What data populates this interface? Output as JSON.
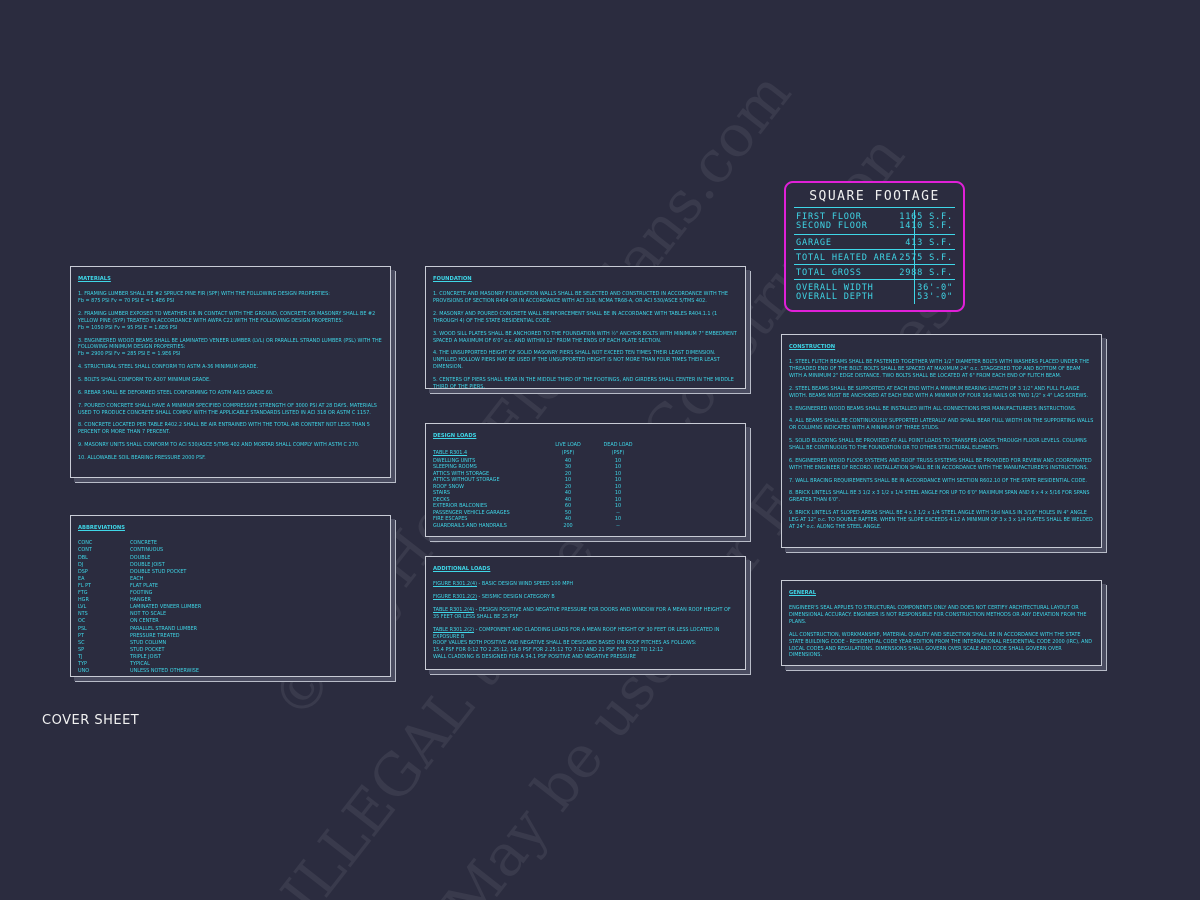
{
  "watermark": {
    "line1": "© MyHomeFloorPlans.com",
    "line2": "ILLEGAL to use for Construction",
    "line3": "May be used for Estimates"
  },
  "materials": {
    "title": "MATERIALS",
    "paras": [
      "1. FRAMING LUMBER SHALL BE #2 SPRUCE PINE FIR (SPF) WITH THE FOLLOWING DESIGN PROPERTIES:",
      "Fb = 875 PSI      Fv = 70 PSI      E = 1.4E6 PSI",
      "2. FRAMING LUMBER EXPOSED TO WEATHER OR IN CONTACT WITH THE GROUND, CONCRETE OR MASONRY SHALL BE #2 YELLOW PINE (SYP) TREATED IN ACCORDANCE WITH AWPA C22 WITH THE FOLLOWING DESIGN PROPERTIES:",
      "Fb = 1050 PSI      Fv = 95 PSI      E = 1.6E6 PSI",
      "3. ENGINEERED WOOD BEAMS SHALL BE LAMINATED VENEER LUMBER (LVL) OR PARALLEL STRAND LUMBER (PSL) WITH THE FOLLOWING MINIMUM DESIGN PROPERTIES:",
      "Fb = 2900 PSI      Fv = 285 PSI      E = 1.9E6 PSI",
      "4. STRUCTURAL STEEL SHALL CONFORM TO ASTM A-36 MINIMUM GRADE.",
      "5. BOLTS SHALL CONFORM TO A307 MINIMUM GRADE.",
      "6. REBAR SHALL BE DEFORMED STEEL CONFORMING TO ASTM A615 GRADE 60.",
      "7. POURED CONCRETE SHALL HAVE A MINIMUM SPECIFIED COMPRESSIVE STRENGTH OF 3000 PSI AT 28 DAYS. MATERIALS USED TO PRODUCE CONCRETE SHALL COMPLY WITH THE APPLICABLE STANDARDS LISTED IN ACI 318 OR ASTM C 1157.",
      "8. CONCRETE LOCATED PER TABLE R402.2 SHALL BE AIR ENTRAINED WITH THE TOTAL AIR CONTENT NOT LESS THAN 5 PERCENT OR MORE THAN 7 PERCENT.",
      "9. MASONRY UNITS SHALL CONFORM TO ACI 530/ASCE 5/TMS 402 AND MORTAR SHALL COMPLY WITH ASTM C 270.",
      "10. ALLOWABLE SOIL BEARING PRESSURE 2000 PSF."
    ]
  },
  "abbreviations": {
    "title": "ABBREVIATIONS",
    "rows": [
      [
        "CONC",
        "CONCRETE"
      ],
      [
        "CONT",
        "CONTINUOUS"
      ],
      [
        "DBL",
        "DOUBLE"
      ],
      [
        "DJ",
        "DOUBLE JOIST"
      ],
      [
        "DSP",
        "DOUBLE STUD POCKET"
      ],
      [
        "EA",
        "EACH"
      ],
      [
        "FL PT",
        "FLAT PLATE"
      ],
      [
        "FTG",
        "FOOTING"
      ],
      [
        "HGR",
        "HANGER"
      ],
      [
        "LVL",
        "LAMINATED VENEER LUMBER"
      ],
      [
        "NTS",
        "NOT TO SCALE"
      ],
      [
        "OC",
        "ON CENTER"
      ],
      [
        "PSL",
        "PARALLEL STRAND LUMBER"
      ],
      [
        "PT",
        "PRESSURE TREATED"
      ],
      [
        "SC",
        "STUD COLUMN"
      ],
      [
        "SP",
        "STUD POCKET"
      ],
      [
        "TJ",
        "TRIPLE JOIST"
      ],
      [
        "TYP",
        "TYPICAL"
      ],
      [
        "UNO",
        "UNLESS NOTED OTHERWISE"
      ]
    ]
  },
  "foundation": {
    "title": "FOUNDATION",
    "paras": [
      "1. CONCRETE AND MASONRY FOUNDATION WALLS SHALL BE SELECTED AND CONSTRUCTED IN ACCORDANCE WITH THE PROVISIONS OF SECTION R404 OR IN ACCORDANCE WITH ACI 318, NCMA TR68-A, OR ACI 530/ASCE 5/TMS 402.",
      "2. MASONRY AND POURED CONCRETE WALL REINFORCEMENT SHALL BE IN ACCORDANCE WITH TABLES R404.1.1 (1 THROUGH 4) OF THE STATE RESIDENTIAL CODE.",
      "3. WOOD SILL PLATES SHALL BE ANCHORED TO THE FOUNDATION WITH ½\" ANCHOR BOLTS WITH MINIMUM 7\" EMBEDMENT SPACED A MAXIMUM OF 6'0\" o.c. AND WITHIN 12\" FROM THE ENDS OF EACH PLATE SECTION.",
      "4. THE UNSUPPORTED HEIGHT OF SOLID MASONRY PIERS SHALL NOT EXCEED TEN TIMES THEIR LEAST DIMENSION. UNFILLED HOLLOW PIERS MAY BE USED IF THE UNSUPPORTED HEIGHT IS NOT MORE THAN FOUR TIMES THEIR LEAST DIMENSION.",
      "5. CENTERS OF PIERS SHALL BEAR IN THE MIDDLE THIRD OF THE FOOTINGS, AND GIRDERS SHALL CENTER IN THE MIDDLE THIRD OF THE PIERS."
    ]
  },
  "design_loads": {
    "title": "DESIGN LOADS",
    "col_live": "LIVE LOAD",
    "col_dead": "DEAD LOAD",
    "unit_live": "(PSF)",
    "unit_dead": "(PSF)",
    "table_ref": "TABLE R301.4",
    "rows": [
      [
        "DWELLING UNITS",
        "40",
        "10"
      ],
      [
        "SLEEPING ROOMS",
        "30",
        "10"
      ],
      [
        "ATTICS WITH STORAGE",
        "20",
        "10"
      ],
      [
        "ATTICS WITHOUT STORAGE",
        "10",
        "10"
      ],
      [
        "ROOF SNOW",
        "20",
        "10"
      ],
      [
        "STAIRS",
        "40",
        "10"
      ],
      [
        "DECKS",
        "40",
        "10"
      ],
      [
        "EXTERIOR BALCONIES",
        "60",
        "10"
      ],
      [
        "PASSENGER VEHICLE GARAGES",
        "50",
        "--"
      ],
      [
        "FIRE ESCAPES",
        "40",
        "10"
      ],
      [
        "GUARDRAILS AND HANDRAILS",
        "200",
        "--"
      ]
    ]
  },
  "additional_loads": {
    "title": "ADDITIONAL LOADS",
    "items": [
      {
        "ref": "FIGURE R301.2(4)",
        "text": " - BASIC DESIGN WIND SPEED 100 MPH"
      },
      {
        "ref": "FIGURE R301.2(2)",
        "text": " - SEISMIC DESIGN CATEGORY B"
      },
      {
        "ref": "TABLE R301.2(4)",
        "text": " - DESIGN POSITIVE AND NEGATIVE PRESSURE FOR DOORS AND WINDOW FOR A MEAN ROOF HEIGHT OF 35 FEET OR LESS SHALL BE 25 PSF"
      },
      {
        "ref": "TABLE R301.2(2)",
        "text": " - COMPONENT AND CLADDING LOADS FOR A MEAN ROOF HEIGHT OF 30 FEET OR LESS LOCATED IN EXPOSURE B"
      }
    ],
    "extra": [
      "ROOF VALUES BOTH POSITIVE AND NEGATIVE SHALL BE DESIGNED BASED ON ROOF PITCHES AS FOLLOWS:",
      "15.4 PSF FOR 0:12 TO 2.25:12, 14.8 PSF FOR 2.25:12 TO 7:12 AND 21 PSF FOR 7:12 TO 12:12",
      "WALL CLADDING IS DESIGNED FOR A 34.1 PSF POSITIVE AND NEGATIVE PRESSURE"
    ]
  },
  "square_footage": {
    "title": "SQUARE FOOTAGE",
    "first_floor_label": "FIRST FLOOR",
    "first_floor_value": "1165 S.F.",
    "second_floor_label": "SECOND FLOOR",
    "second_floor_value": "1410 S.F.",
    "garage_label": "GARAGE",
    "garage_value": "413 S.F.",
    "heated_label": "TOTAL HEATED AREA",
    "heated_value": "2575 S.F.",
    "gross_label": "TOTAL GROSS",
    "gross_value": "2988 S.F.",
    "width_label": "OVERALL WIDTH",
    "width_value": "36'-0\"",
    "depth_label": "OVERALL DEPTH",
    "depth_value": "53'-0\""
  },
  "construction": {
    "title": "CONSTRUCTION",
    "paras": [
      "1. STEEL FLITCH BEAMS SHALL BE FASTENED TOGETHER WITH 1/2\" DIAMETER BOLTS WITH WASHERS PLACED UNDER THE THREADED END OF THE BOLT. BOLTS SHALL BE SPACED AT MAXIMUM 24\" o.c. STAGGERED TOP AND BOTTOM OF BEAM WITH A MINIMUM 2\" EDGE DISTANCE. TWO BOLTS SHALL BE LOCATED AT 6\" FROM EACH END OF FLITCH BEAM.",
      "2. STEEL BEAMS SHALL BE SUPPORTED AT EACH END WITH A MINIMUM BEARING LENGTH OF 3 1/2\" AND FULL FLANGE WIDTH. BEAMS MUST BE ANCHORED AT EACH END WITH A MINIMUM OF FOUR 16d NAILS OR TWO 1/2\" x 4\" LAG SCREWS.",
      "3. ENGINEERED WOOD BEAMS SHALL BE INSTALLED WITH ALL CONNECTIONS PER MANUFACTURER'S INSTRUCTIONS.",
      "4. ALL BEAMS SHALL BE CONTINUOUSLY SUPPORTED LATERALLY AND SHALL BEAR FULL WIDTH ON THE SUPPORTING WALLS OR COLUMNS INDICATED WITH A MINIMUM OF THREE STUDS.",
      "5. SOLID BLOCKING SHALL BE PROVIDED AT ALL POINT LOADS TO TRANSFER LOADS THROUGH FLOOR LEVELS. COLUMNS SHALL BE CONTINUOUS TO THE FOUNDATION OR TO OTHER STRUCTURAL ELEMENTS.",
      "6. ENGINEERED WOOD FLOOR SYSTEMS AND ROOF TRUSS SYSTEMS SHALL BE PROVIDED FOR REVIEW AND COORDINATED WITH THE ENGINEER OF RECORD. INSTALLATION SHALL BE IN ACCORDANCE WITH THE MANUFACTURER'S INSTRUCTIONS.",
      "7. WALL BRACING REQUIREMENTS SHALL BE IN ACCORDANCE WITH SECTION R602.10 OF THE STATE RESIDENTIAL CODE.",
      "8. BRICK LINTELS SHALL BE 3 1/2 x 3 1/2 x 1/4 STEEL ANGLE FOR UP TO 6'0\" MAXIMUM SPAN AND 6 x 4 x 5/16 FOR SPANS GREATER THAN 6'0\".",
      "9. BRICK LINTELS AT SLOPED AREAS SHALL BE 4 x 3 1/2 x 1/4 STEEL ANGLE WITH 16d NAILS IN 3/16\" HOLES IN 4\" ANGLE LEG AT 12\" o.c. TO DOUBLE RAFTER. WHEN THE SLOPE EXCEEDS 4:12 A MINIMUM OF 3 x 3 x 1/4 PLATES SHALL BE WELDED AT 24\" o.c. ALONG THE STEEL ANGLE."
    ]
  },
  "general": {
    "title": "GENERAL",
    "paras": [
      "ENGINEER'S SEAL APPLIES TO STRUCTURAL COMPONENTS ONLY AND DOES NOT CERTIFY ARCHITECTURAL LAYOUT OR DIMENSIONAL ACCURACY. ENGINEER IS NOT RESPONSIBLE FOR CONSTRUCTION METHODS OR ANY DEVIATION FROM THE PLANS.",
      "ALL CONSTRUCTION, WORKMANSHIP, MATERIAL QUALITY AND SELECTION SHALL BE IN ACCORDANCE WITH THE STATE STATE BUILDING CODE - RESIDENTIAL CODE YEAR EDITION FROM THE INTERNATIONAL RESIDENTIAL CODE 2000 (IRC), AND LOCAL CODES AND REGULATIONS. DIMENSIONS SHALL GOVERN OVER SCALE AND CODE SHALL GOVERN OVER DIMENSIONS."
    ]
  },
  "cover_sheet": "COVER SHEET",
  "colors": {
    "background": "#2b2c3f",
    "text": "#3fd7e8",
    "square_footage_border": "#e020d8"
  }
}
